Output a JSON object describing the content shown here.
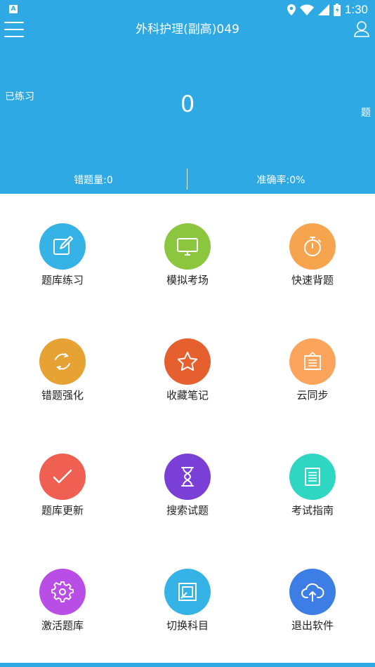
{
  "status_bar": {
    "time": "1:30",
    "app_badge": "A"
  },
  "header": {
    "title": "外科护理(副高)049",
    "practiced_label": "已练习",
    "count": "0",
    "unit": "题",
    "wrong_count": "错题量:0",
    "accuracy": "准确率:0%"
  },
  "menu": [
    {
      "label": "题库练习",
      "icon": "edit-icon",
      "color": "#35b2e6"
    },
    {
      "label": "模拟考场",
      "icon": "monitor-icon",
      "color": "#8cc63f"
    },
    {
      "label": "快速背题",
      "icon": "stopwatch-icon",
      "color": "#f7a44f"
    },
    {
      "label": "错题强化",
      "icon": "refresh-icon",
      "color": "#e6a233"
    },
    {
      "label": "收藏笔记",
      "icon": "star-icon",
      "color": "#e5602e"
    },
    {
      "label": "云同步",
      "icon": "board-icon",
      "color": "#fca35c"
    },
    {
      "label": "题库更新",
      "icon": "check-icon",
      "color": "#ef5f52"
    },
    {
      "label": "搜索试题",
      "icon": "hourglass-icon",
      "color": "#7a3fd6"
    },
    {
      "label": "考试指南",
      "icon": "document-icon",
      "color": "#2fd6c2"
    },
    {
      "label": "激活题库",
      "icon": "gear-icon",
      "color": "#b84ee6"
    },
    {
      "label": "切换科目",
      "icon": "switch-icon",
      "color": "#35b2e6"
    },
    {
      "label": "退出软件",
      "icon": "cloud-upload-icon",
      "color": "#3c7ee6"
    }
  ]
}
